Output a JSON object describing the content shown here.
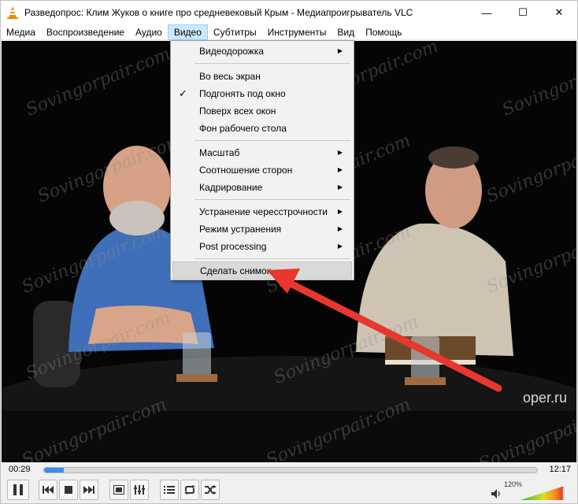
{
  "window": {
    "title": "Разведопрос: Клим Жуков о книге про средневековый Крым - Медиапроигрыватель VLC",
    "minimize": "—",
    "maximize": "☐",
    "close": "✕"
  },
  "menubar": {
    "items": [
      "Медиа",
      "Воспроизведение",
      "Аудио",
      "Видео",
      "Субтитры",
      "Инструменты",
      "Вид",
      "Помощь"
    ],
    "active_index": 3
  },
  "video_menu": {
    "items": [
      {
        "label": "Видеодорожка",
        "submenu": true
      },
      {
        "label": "Во весь экран"
      },
      {
        "label": "Подгонять под окно",
        "checked": true
      },
      {
        "label": "Поверх всех окон"
      },
      {
        "label": "Фон рабочего стола"
      },
      {
        "label": "Масштаб",
        "submenu": true
      },
      {
        "label": "Соотношение сторон",
        "submenu": true
      },
      {
        "label": "Кадрирование",
        "submenu": true
      },
      {
        "label": "Устранение чересстрочности",
        "submenu": true
      },
      {
        "label": "Режим устранения",
        "submenu": true
      },
      {
        "label": "Post processing",
        "submenu": true
      },
      {
        "label": "Сделать снимок",
        "highlighted": true
      }
    ]
  },
  "video": {
    "watermark": "Sovingorpair.com",
    "channel_logo": "oper.ru"
  },
  "playback": {
    "elapsed": "00:29",
    "total": "12:17",
    "progress_fraction": 0.04
  },
  "controls": {
    "pause_icon": "pause-icon",
    "prev_icon": "previous-icon",
    "stop_icon": "stop-icon",
    "next_icon": "next-icon",
    "fullscreen_icon": "fullscreen-icon",
    "extended_icon": "equalizer-icon",
    "playlist_icon": "playlist-icon",
    "loop_icon": "loop-icon",
    "random_icon": "shuffle-icon",
    "volume_percent": "120%",
    "volume_level": 1.2
  },
  "colors": {
    "accent": "#3a8ee6",
    "arrow": "#e8372c",
    "menu_active": "#cce8ff"
  }
}
